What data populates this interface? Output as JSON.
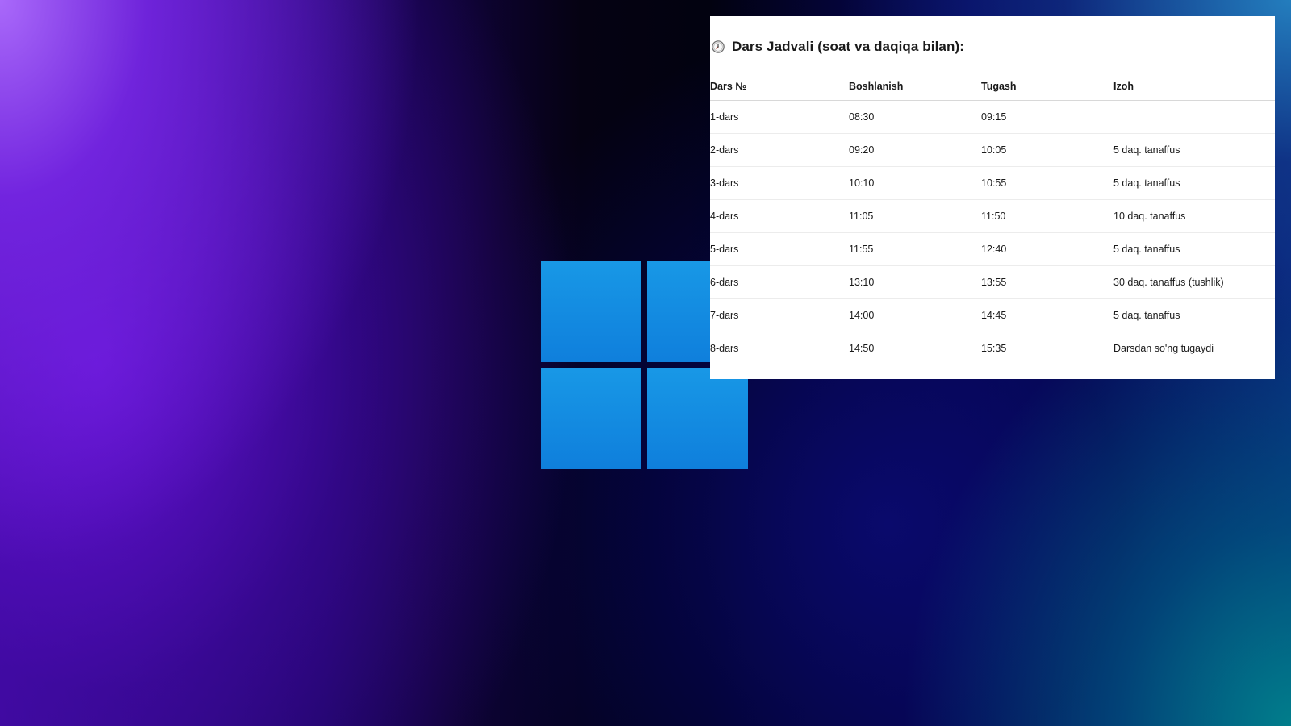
{
  "desktop": {
    "logo": "windows-logo-icon"
  },
  "schedule_panel": {
    "icon": "clock-icon",
    "title": "Dars Jadvali (soat va daqiqa bilan):",
    "columns": [
      "Dars №",
      "Boshlanish",
      "Tugash",
      "Izoh"
    ],
    "rows": [
      [
        "1-dars",
        "08:30",
        "09:15",
        ""
      ],
      [
        "2-dars",
        "09:20",
        "10:05",
        "5 daq. tanaffus"
      ],
      [
        "3-dars",
        "10:10",
        "10:55",
        "5 daq. tanaffus"
      ],
      [
        "4-dars",
        "11:05",
        "11:50",
        "10 daq. tanaffus"
      ],
      [
        "5-dars",
        "11:55",
        "12:40",
        "5 daq. tanaffus"
      ],
      [
        "6-dars",
        "13:10",
        "13:55",
        "30 daq. tanaffus (tushlik)"
      ],
      [
        "7-dars",
        "14:00",
        "14:45",
        "5 daq. tanaffus"
      ],
      [
        "8-dars",
        "14:50",
        "15:35",
        "Darsdan so'ng tugaydi"
      ]
    ]
  },
  "colors": {
    "logo_blue": "#1590e0",
    "panel_background": "#ffffff",
    "text": "#1a1a1a"
  }
}
